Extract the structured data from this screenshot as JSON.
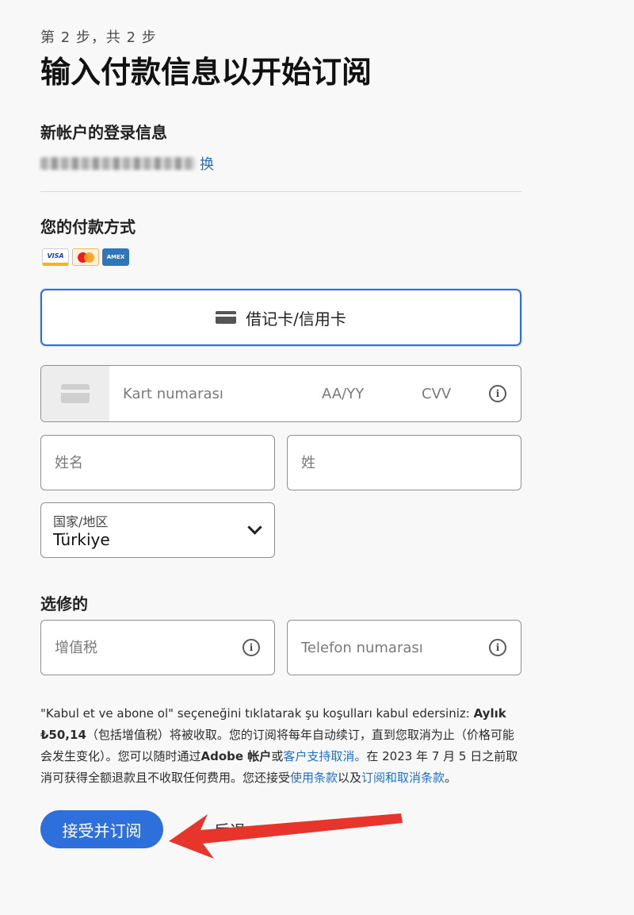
{
  "header": {
    "step": "第 2 步，共 2 步",
    "title": "输入付款信息以开始订阅"
  },
  "account": {
    "heading": "新帐户的登录信息",
    "change_link": "换"
  },
  "payment": {
    "heading": "您的付款方式",
    "card_logos": {
      "visa": "VISA",
      "amex": "AMEX"
    },
    "method_button": "借记卡/信用卡",
    "card_number_placeholder": "Kart numarası",
    "expiry_placeholder": "AA/YY",
    "cvv_placeholder": "CVV",
    "first_name_placeholder": "姓名",
    "last_name_placeholder": "姓",
    "country_label": "国家/地区",
    "country_value": "Türkiye"
  },
  "optional": {
    "heading": "选修的",
    "vat_placeholder": "增值税",
    "phone_placeholder": "Telefon numarası"
  },
  "legal": {
    "text_1": "\"Kabul et ve abone ol\" seçeneğini tıklatarak şu koşulları kabul edersiniz: ",
    "price": "Aylık ₺50,14",
    "text_2": "（包括增值税）将被收取。您的订阅将每年自动续订，直到您取消为止（价格可能会发生变化）。您可以随时通过",
    "adobe_account": "Adobe 帐户",
    "text_3": "或",
    "support_link": "客户支持取消。",
    "text_4": "在 2023 年 7 月 5 日之前取消可获得全额退款且不收取任何费用。您还接受",
    "terms_link": "使用条款",
    "text_5": "以及",
    "cancel_terms_link": "订阅和取消条款",
    "text_6": "。"
  },
  "actions": {
    "accept": "接受并订阅",
    "back": "后退"
  },
  "colors": {
    "accent": "#2d6fdb",
    "link": "#1f6fd1",
    "annotation_arrow": "#e8352b"
  }
}
